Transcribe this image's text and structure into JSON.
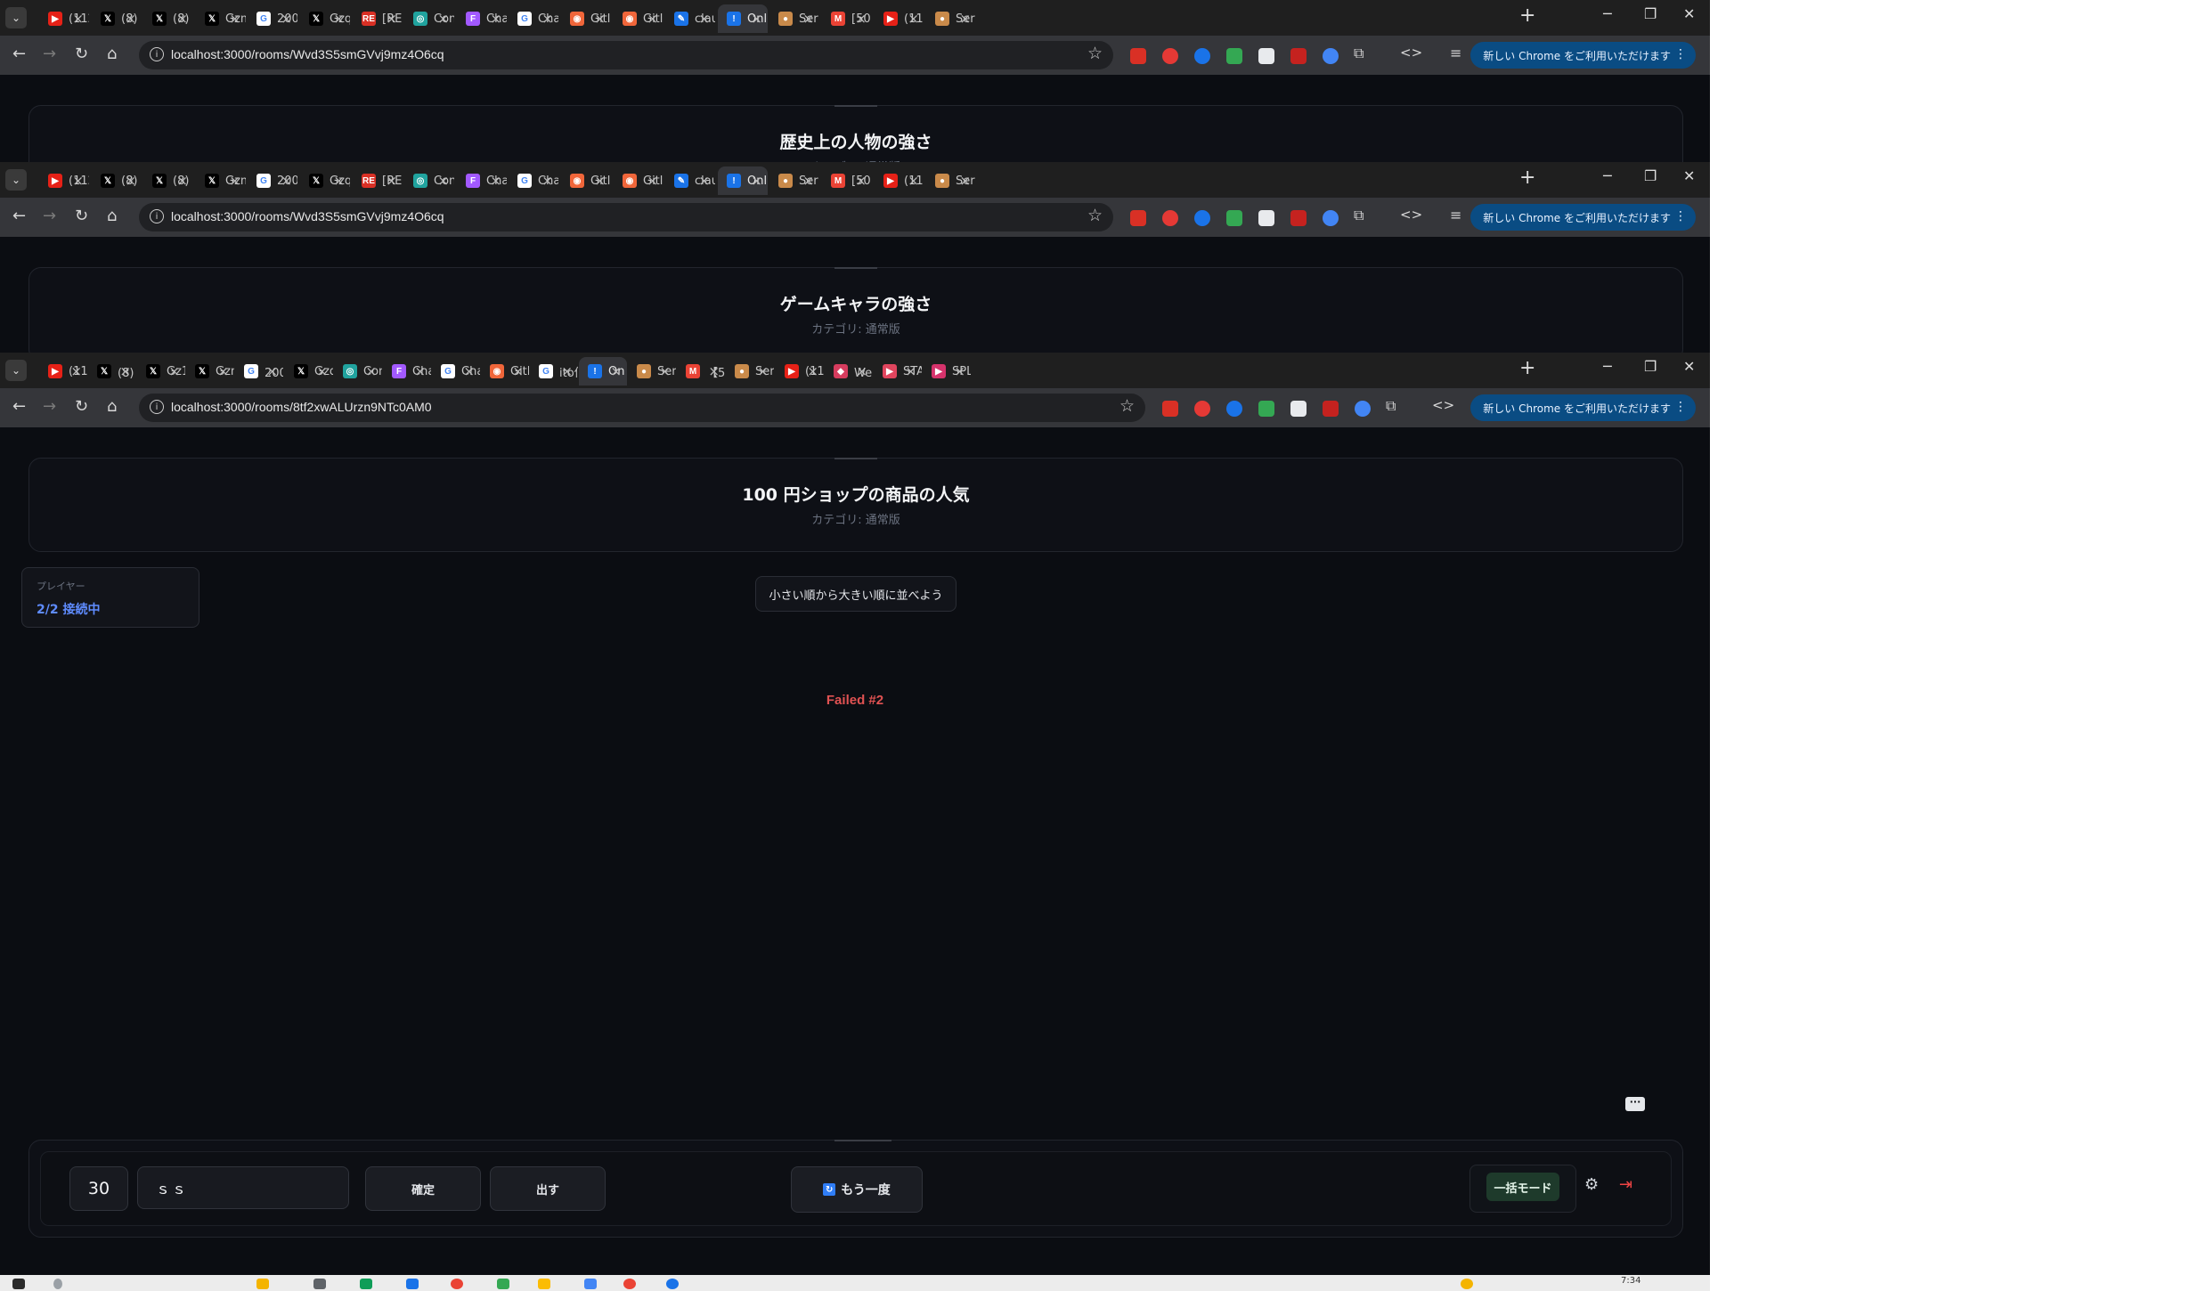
{
  "windows": [
    {
      "tabs": [
        {
          "label": "(112",
          "icon": "youtube-icon",
          "color": "#e62117"
        },
        {
          "label": "(8) c",
          "icon": "x-icon",
          "color": "#000000"
        },
        {
          "label": "(8) >",
          "icon": "x-icon",
          "color": "#000000"
        },
        {
          "label": "Gzm",
          "icon": "x-icon",
          "color": "#000000"
        },
        {
          "label": "200",
          "icon": "google-icon",
          "color": "#ffffff"
        },
        {
          "label": "Gzq",
          "icon": "x-icon",
          "color": "#000000"
        },
        {
          "label": "[RE",
          "icon": "re-icon",
          "color": "#d93025"
        },
        {
          "label": "Con",
          "icon": "contrib-icon",
          "color": "#20a39e"
        },
        {
          "label": "Cha",
          "icon": "figma-icon",
          "color": "#a259ff"
        },
        {
          "label": "Cha",
          "icon": "google-icon",
          "color": "#ffffff"
        },
        {
          "label": "Gitl",
          "icon": "github-icon",
          "color": "#f0663a"
        },
        {
          "label": "Gitl",
          "icon": "github-icon",
          "color": "#f0663a"
        },
        {
          "label": "clau",
          "icon": "claude-icon",
          "color": "#1a73e8"
        },
        {
          "label": "Onl",
          "icon": "online-icon",
          "color": "#1a73e8",
          "active": true
        },
        {
          "label": "Ser",
          "icon": "serena-icon",
          "color": "#c98a4a"
        },
        {
          "label": "[50",
          "icon": "gmail-icon",
          "color": "#ea4335"
        },
        {
          "label": "(11",
          "icon": "youtube-icon",
          "color": "#e62117"
        },
        {
          "label": "Ser",
          "icon": "serena-icon",
          "color": "#c98a4a"
        }
      ],
      "url": "localhost:3000/rooms/Wvd3S5smGVvj9mz4O6cq",
      "title": "歴史上の人物の強さ",
      "subtitle": "カテゴリ: 通常版"
    },
    {
      "tabs": [
        {
          "label": "(112",
          "icon": "youtube-icon",
          "color": "#e62117"
        },
        {
          "label": "(8) c",
          "icon": "x-icon",
          "color": "#000000"
        },
        {
          "label": "(8) >",
          "icon": "x-icon",
          "color": "#000000"
        },
        {
          "label": "Gzm",
          "icon": "x-icon",
          "color": "#000000"
        },
        {
          "label": "200",
          "icon": "google-icon",
          "color": "#ffffff"
        },
        {
          "label": "Gzq",
          "icon": "x-icon",
          "color": "#000000"
        },
        {
          "label": "[RE",
          "icon": "re-icon",
          "color": "#d93025"
        },
        {
          "label": "Con",
          "icon": "contrib-icon",
          "color": "#20a39e"
        },
        {
          "label": "Cha",
          "icon": "figma-icon",
          "color": "#a259ff"
        },
        {
          "label": "Cha",
          "icon": "google-icon",
          "color": "#ffffff"
        },
        {
          "label": "Gitl",
          "icon": "github-icon",
          "color": "#f0663a"
        },
        {
          "label": "Gitl",
          "icon": "github-icon",
          "color": "#f0663a"
        },
        {
          "label": "clau",
          "icon": "claude-icon",
          "color": "#1a73e8"
        },
        {
          "label": "Onl",
          "icon": "online-icon",
          "color": "#1a73e8",
          "active": true
        },
        {
          "label": "Ser",
          "icon": "serena-icon",
          "color": "#c98a4a"
        },
        {
          "label": "[50",
          "icon": "gmail-icon",
          "color": "#ea4335"
        },
        {
          "label": "(11",
          "icon": "youtube-icon",
          "color": "#e62117"
        },
        {
          "label": "Ser",
          "icon": "serena-icon",
          "color": "#c98a4a"
        }
      ],
      "url": "localhost:3000/rooms/Wvd3S5smGVvj9mz4O6cq",
      "title": "ゲームキャラの強さ",
      "subtitle": "カテゴリ: 通常版"
    },
    {
      "tabs": [
        {
          "label": "(114) [",
          "icon": "youtube-icon",
          "color": "#e62117"
        },
        {
          "label": "(8) ホー",
          "icon": "x-icon",
          "color": "#000000"
        },
        {
          "label": "Gz1Zbj",
          "icon": "x-icon",
          "color": "#000000"
        },
        {
          "label": "Gzm-9",
          "icon": "x-icon",
          "color": "#000000"
        },
        {
          "label": "200ドル",
          "icon": "google-icon",
          "color": "#ffffff"
        },
        {
          "label": "Gzqngc",
          "icon": "x-icon",
          "color": "#000000"
        },
        {
          "label": "Contrib",
          "icon": "contrib-icon",
          "color": "#20a39e"
        },
        {
          "label": "Chakra",
          "icon": "figma-icon",
          "color": "#a259ff"
        },
        {
          "label": "Chakra",
          "icon": "google-icon",
          "color": "#ffffff"
        },
        {
          "label": "GitHub",
          "icon": "github-icon",
          "color": "#f0663a"
        },
        {
          "label": "ito何人",
          "icon": "google-icon",
          "color": "#ffffff"
        },
        {
          "label": "On",
          "icon": "online-icon",
          "color": "#1a73e8",
          "active": true
        },
        {
          "label": "Serena",
          "icon": "serena-icon",
          "color": "#c98a4a"
        },
        {
          "label": "【50%C",
          "icon": "gmail-icon",
          "color": "#ea4335"
        },
        {
          "label": "Serena",
          "icon": "serena-icon",
          "color": "#c98a4a"
        },
        {
          "label": "(114) G",
          "icon": "youtube-icon",
          "color": "#e62117"
        },
        {
          "label": "Webフ",
          "icon": "web-icon",
          "color": "#d63c5e"
        },
        {
          "label": "START",
          "icon": "start-icon",
          "color": "#e0455e"
        },
        {
          "label": "SPLY-D",
          "icon": "sply-icon",
          "color": "#d6336c"
        }
      ],
      "url": "localhost:3000/rooms/8tf2xwALUrzn9NTc0AM0",
      "title": "100 円ショップの商品の人気",
      "subtitle": "カテゴリ: 通常版"
    }
  ],
  "chrome_update_label": "新しい Chrome をご利用いただけます",
  "player_panel": {
    "label": "プレイヤー",
    "value": "2/2 接続中"
  },
  "instruction": "小さい順から大きい順に並べよう",
  "status": "Failed #2",
  "controls": {
    "number": "30",
    "text_value": "ｓｓ",
    "confirm_label": "確定",
    "play_label": "出す",
    "retry_label": "もう一度",
    "bulk_mode_label": "一括モード"
  },
  "taskbar_time": "7:34",
  "colors": {
    "accent": "#5f8cff",
    "error": "#e05252",
    "bulk_bg": "#1e3a2b",
    "exit": "#ef4444"
  }
}
